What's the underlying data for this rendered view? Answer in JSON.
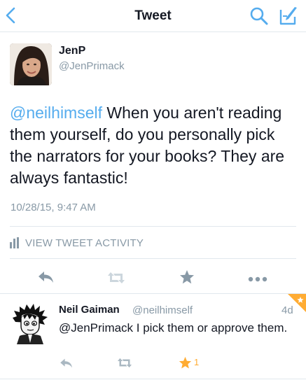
{
  "header": {
    "title": "Tweet",
    "back_icon": "chevron-left-icon",
    "search_icon": "search-icon",
    "compose_icon": "compose-icon",
    "accent_color": "#55acee"
  },
  "tweet": {
    "author": {
      "name": "JenP",
      "handle": "@JenPrimack"
    },
    "mention": "@neilhimself",
    "text": " When you aren't reading them yourself, do you personally pick the narrators for your books? They are always fantastic!",
    "timestamp": "10/28/15, 9:47 AM",
    "activity_label": "VIEW TWEET ACTIVITY",
    "actions": {
      "reply_icon": "reply-icon",
      "retweet_icon": "retweet-icon",
      "favorite_icon": "star-icon",
      "more_icon": "more-dots-icon"
    }
  },
  "reply": {
    "author": {
      "name": "Neil Gaiman",
      "handle": "@neilhimself"
    },
    "time": "4d",
    "text": "@JenPrimack  I pick them or approve them.",
    "favorite_count": "1",
    "favorited": true,
    "favorite_color": "#ffac33"
  }
}
